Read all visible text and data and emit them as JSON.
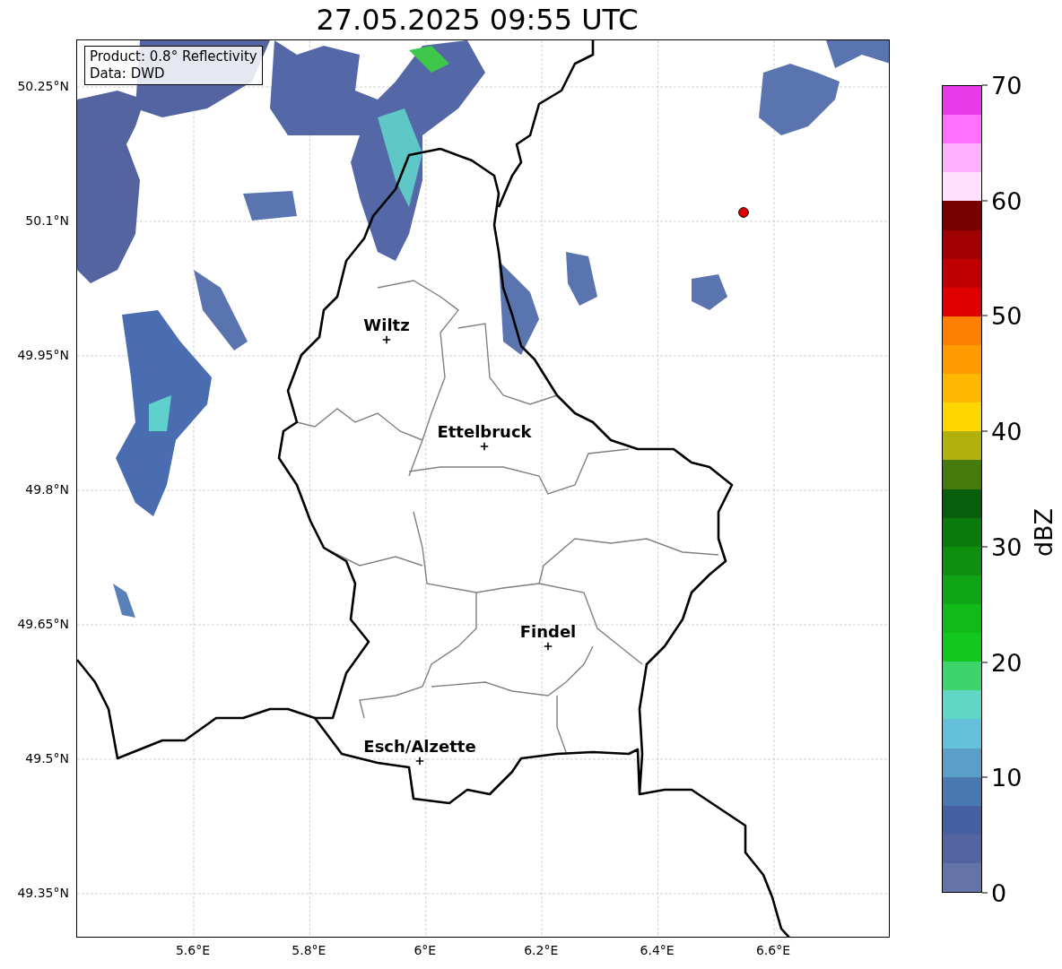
{
  "title": "27.05.2025 09:55 UTC",
  "info_box": [
    "Product: 0.8° Reflectivity",
    "Data: DWD"
  ],
  "lat_labels": [
    "50.25°N",
    "50.1°N",
    "49.95°N",
    "49.8°N",
    "49.65°N",
    "49.5°N",
    "49.35°N"
  ],
  "lon_labels": [
    "5.6°E",
    "5.8°E",
    "6°E",
    "6.2°E",
    "6.4°E",
    "6.6°E"
  ],
  "cities": [
    {
      "name": "Wiltz"
    },
    {
      "name": "Ettelbruck"
    },
    {
      "name": "Findel"
    },
    {
      "name": "Esch/Alzette"
    }
  ],
  "colorbar": {
    "label": "dBZ",
    "ticks": [
      "70",
      "60",
      "50",
      "40",
      "30",
      "20",
      "10",
      "0"
    ],
    "bands": [
      {
        "color": "#e83ae8"
      },
      {
        "color": "#ff70ff"
      },
      {
        "color": "#ffb0ff"
      },
      {
        "color": "#ffe0ff"
      },
      {
        "color": "#780000"
      },
      {
        "color": "#a00000"
      },
      {
        "color": "#c00000"
      },
      {
        "color": "#e00000"
      },
      {
        "color": "#ff7f00"
      },
      {
        "color": "#ff9a00"
      },
      {
        "color": "#ffb800"
      },
      {
        "color": "#ffd700"
      },
      {
        "color": "#b0b10a"
      },
      {
        "color": "#477a0c"
      },
      {
        "color": "#075e0b"
      },
      {
        "color": "#0a7a0c"
      },
      {
        "color": "#0e8f10"
      },
      {
        "color": "#10a514"
      },
      {
        "color": "#10bb18"
      },
      {
        "color": "#12c81e"
      },
      {
        "color": "#3dd46c"
      },
      {
        "color": "#5fd6c6"
      },
      {
        "color": "#65c0dc"
      },
      {
        "color": "#5a9fc8"
      },
      {
        "color": "#4a78b0"
      },
      {
        "color": "#4560a0"
      },
      {
        "color": "#5464a0"
      },
      {
        "color": "#6474a8"
      }
    ]
  }
}
